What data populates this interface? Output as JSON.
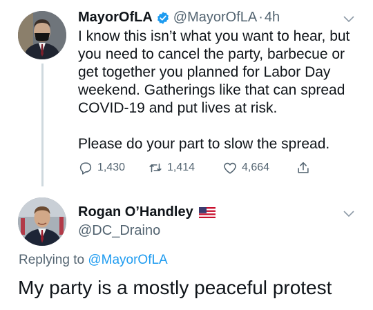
{
  "tweet": {
    "author_name": "MayorOfLA",
    "verified": true,
    "handle": "@MayorOfLA",
    "separator": "·",
    "time": "4h",
    "lines": [
      "I know this isn’t what you want to hear, but",
      "you need to cancel the party, barbecue or",
      "get together you planned for Labor Day",
      "weekend. Gatherings like that can spread",
      "COVID-19 and put lives at risk."
    ],
    "closing_line": "Please do your part to slow the spread.",
    "actions": {
      "replies": "1,430",
      "retweets": "1,414",
      "likes": "4,664"
    }
  },
  "reply": {
    "author_name": "Rogan O’Handley",
    "flag_icon": "us-flag-icon",
    "handle": "@DC_Draino",
    "replying_prefix": "Replying to",
    "replying_to": "@MayorOfLA",
    "text": "My party is a mostly peaceful protest"
  },
  "colors": {
    "accent": "#1d9bf0",
    "secondary_text": "#536471",
    "primary_text": "#0f1419",
    "thread_line": "#cfd9de"
  }
}
